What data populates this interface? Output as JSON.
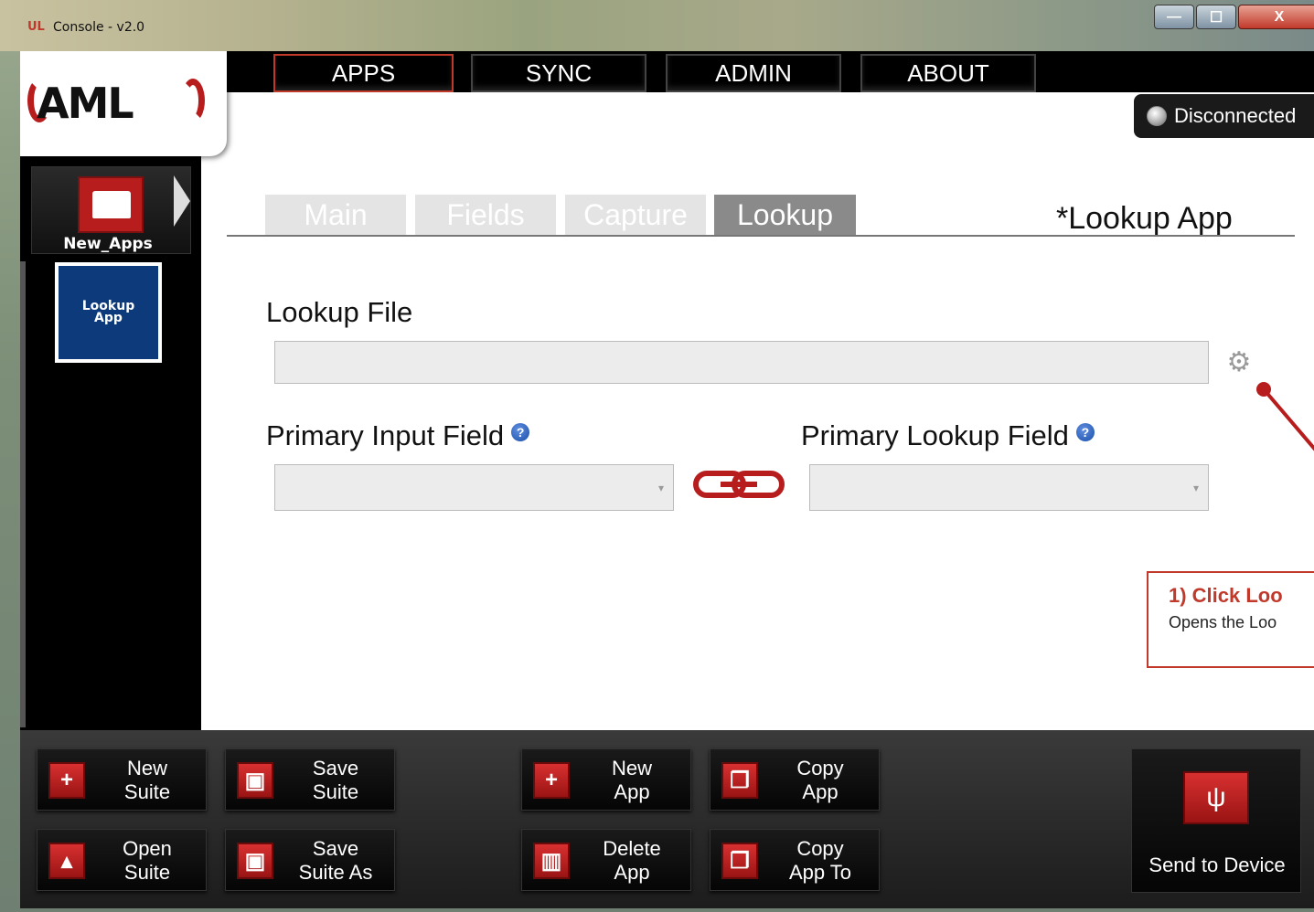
{
  "window": {
    "title": "Console - v2.0",
    "logo_mark": "UL",
    "min_symbol": "—",
    "max_symbol": "☐",
    "close_symbol": "X"
  },
  "brand": {
    "logo": "AML"
  },
  "nav": {
    "tabs": [
      "APPS",
      "SYNC",
      "ADMIN",
      "ABOUT"
    ],
    "active": "APPS"
  },
  "status": {
    "connection": "Disconnected"
  },
  "sidebar": {
    "suite_name": "New_Apps",
    "app_tile": "Lookup App"
  },
  "content_tabs": {
    "items": [
      "Main",
      "Fields",
      "Capture",
      "Lookup"
    ],
    "active": "Lookup"
  },
  "app_title": "*Lookup App",
  "lookup": {
    "file_label": "Lookup File",
    "file_value": "",
    "primary_input_label": "Primary Input Field",
    "primary_lookup_label": "Primary Lookup Field",
    "help_glyph": "?",
    "caret_glyph": "▾",
    "gear_glyph": "⚙"
  },
  "callout": {
    "title": "1) Click Loo",
    "body": "Opens the Loo"
  },
  "toolbar": {
    "new_suite": "New\nSuite",
    "save_suite": "Save\nSuite",
    "new_app": "New\nApp",
    "copy_app": "Copy\nApp",
    "open_suite": "Open\nSuite",
    "save_suite_as": "Save\nSuite As",
    "delete_app": "Delete\nApp",
    "copy_app_to": "Copy\nApp To",
    "send_to_device": "Send to Device"
  },
  "icons": {
    "new_suite": "plus-icon",
    "save_suite": "floppy-icon",
    "new_app": "plus-icon",
    "copy_app": "copy-icon",
    "open_suite": "folder-open-icon",
    "save_suite_as": "floppy-plus-icon",
    "delete_app": "trash-icon",
    "copy_app_to": "copy-to-icon",
    "send_to_device": "usb-icon"
  },
  "colors": {
    "accent": "#b81d1d",
    "app_tile": "#0d3a7a",
    "callout_border": "#c0392b"
  }
}
